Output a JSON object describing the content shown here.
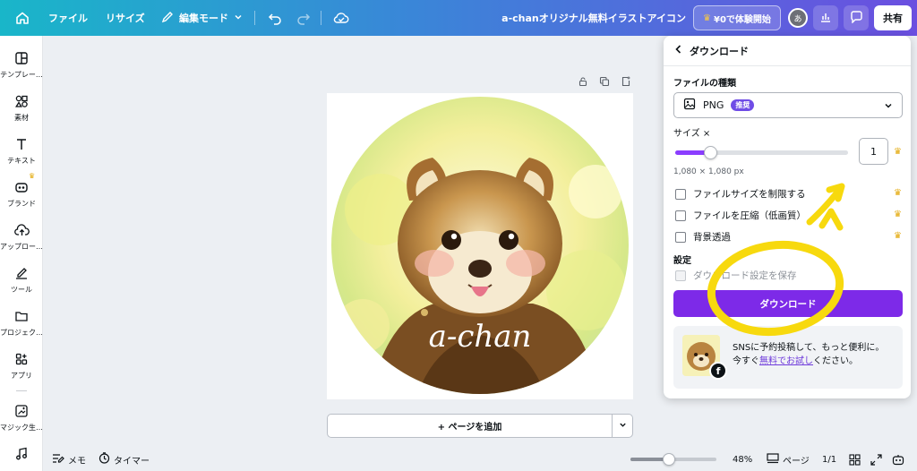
{
  "topbar": {
    "home_icon": "home-icon",
    "file": "ファイル",
    "resize": "リサイズ",
    "edit_mode": "編集モード",
    "title": "a-chanオリジナル無料イラストアイコン",
    "trial": "¥0で体験開始",
    "avatar_initial": "あ",
    "share": "共有"
  },
  "sidebar": {
    "items": [
      {
        "label": "テンプレー…",
        "icon": "template-icon"
      },
      {
        "label": "素材",
        "icon": "elements-icon"
      },
      {
        "label": "テキスト",
        "icon": "text-icon"
      },
      {
        "label": "ブランド",
        "icon": "brand-icon"
      },
      {
        "label": "アップロー…",
        "icon": "upload-icon"
      },
      {
        "label": "ツール",
        "icon": "draw-icon"
      },
      {
        "label": "プロジェク…",
        "icon": "folder-icon"
      },
      {
        "label": "アプリ",
        "icon": "apps-icon"
      },
      {
        "label": "マジック生…",
        "icon": "magic-icon"
      }
    ]
  },
  "canvas": {
    "artwork_text": "a-chan",
    "add_page": "+ ページを追加"
  },
  "bottombar": {
    "notes": "メモ",
    "timer": "タイマー",
    "zoom": "48%",
    "zoom_level": 0.45,
    "pages_label": "ページ",
    "page_count": "1/1"
  },
  "download_panel": {
    "title": "ダウンロード",
    "file_type_label": "ファイルの種類",
    "file_type": "PNG",
    "recommended_badge": "推奨",
    "size_label": "サイズ ×",
    "size_value": "1",
    "size_level": 0.2,
    "dimensions": "1,080 × 1,080 px",
    "options": [
      {
        "label": "ファイルサイズを制限する",
        "premium": true
      },
      {
        "label": "ファイルを圧縮（低画質）",
        "premium": true
      },
      {
        "label": "背景透過",
        "premium": true
      }
    ],
    "settings_label": "設定",
    "save_settings": "ダウンロード設定を保存",
    "download_button": "ダウンロード",
    "promo": {
      "line1": "SNSに予約投稿して、もっと便利に。",
      "line2_pre": "今すぐ",
      "link": "無料でお試し",
      "line2_post": "ください。"
    }
  },
  "colors": {
    "accent": "#7d2ae8",
    "crown": "#e3a90b",
    "annotation": "#f7d90e"
  }
}
